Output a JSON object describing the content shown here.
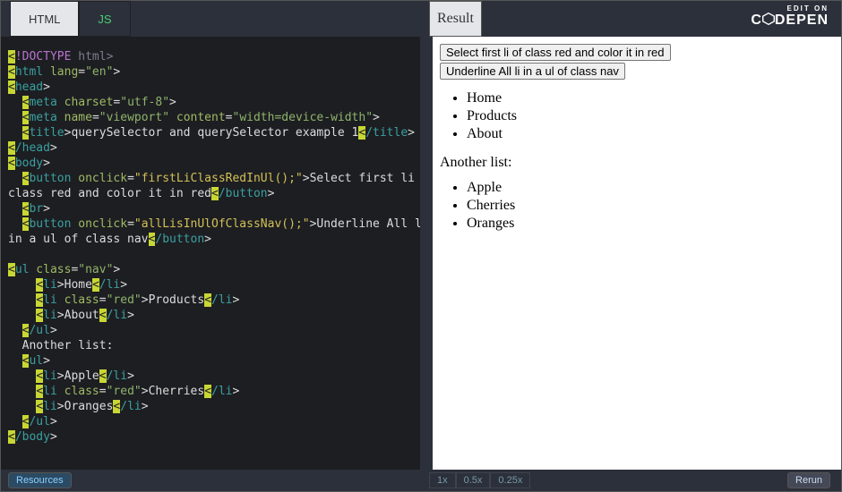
{
  "brand": {
    "tagline": "EDIT ON",
    "name": "C   DEPEN"
  },
  "tabs": {
    "html": "HTML",
    "js": "JS",
    "result": "Result"
  },
  "code": {
    "l1a": "<",
    "l1b": "!DOCTYPE",
    "l1c": " html",
    "l1d": ">",
    "l2a": "<",
    "l2b": "html",
    "l2c": " lang",
    "l2d": "=",
    "l2e": "\"en\"",
    "l2f": ">",
    "l3a": "<",
    "l3b": "head",
    "l3c": ">",
    "l4a": "<",
    "l4b": "meta",
    "l4c": " charset",
    "l4d": "=",
    "l4e": "\"utf-8\"",
    "l4f": ">",
    "l5a": "<",
    "l5b": "meta",
    "l5c": " name",
    "l5d": "=",
    "l5e": "\"viewport\"",
    "l5f": " content",
    "l5g": "=",
    "l5h": "\"width=device-width\"",
    "l5i": ">",
    "l6a": "<",
    "l6b": "title",
    "l6c": ">",
    "l6d": "querySelector and querySelector example 1",
    "l6e": "<",
    "l6f": "/title",
    "l6g": ">",
    "l7a": "<",
    "l7b": "/head",
    "l7c": ">",
    "l8a": "<",
    "l8b": "body",
    "l8c": ">",
    "l9a": "<",
    "l9b": "button",
    "l9c": " onclick",
    "l9d": "=",
    "l9e": "\"firstLiClassRedInUl();\"",
    "l9f": ">",
    "l9g1": "Select first li of ",
    "l9g2": "class red and color it in red",
    "l9h": "<",
    "l9i": "/button",
    "l9j": ">",
    "l10a": "<",
    "l10b": "br",
    "l10c": ">",
    "l11a": "<",
    "l11b": "button",
    "l11c": " onclick",
    "l11d": "=",
    "l11e": "\"allLisInUlOfClassNav();\"",
    "l11f": ">",
    "l11g1": "Underline All li ",
    "l11g2": "in a ul of class nav",
    "l11h": "<",
    "l11i": "/button",
    "l11j": ">",
    "l12a": "<",
    "l12b": "ul",
    "l12c": " class",
    "l12d": "=",
    "l12e": "\"nav\"",
    "l12f": ">",
    "l13a": "<",
    "l13b": "li",
    "l13c": ">",
    "l13d": "Home",
    "l13e": "<",
    "l13f": "/li",
    "l13g": ">",
    "l14a": "<",
    "l14b": "li",
    "l14c": " class",
    "l14d": "=",
    "l14e": "\"red\"",
    "l14f": ">",
    "l14g": "Products",
    "l14h": "<",
    "l14i": "/li",
    "l14j": ">",
    "l15a": "<",
    "l15b": "li",
    "l15c": ">",
    "l15d": "About",
    "l15e": "<",
    "l15f": "/li",
    "l15g": ">",
    "l16a": "<",
    "l16b": "/ul",
    "l16c": ">",
    "l17": "Another list:",
    "l18a": "<",
    "l18b": "ul",
    "l18c": ">",
    "l19a": "<",
    "l19b": "li",
    "l19c": ">",
    "l19d": "Apple",
    "l19e": "<",
    "l19f": "/li",
    "l19g": ">",
    "l20a": "<",
    "l20b": "li",
    "l20c": " class",
    "l20d": "=",
    "l20e": "\"red\"",
    "l20f": ">",
    "l20g": "Cherries",
    "l20h": "<",
    "l20i": "/li",
    "l20j": ">",
    "l21a": "<",
    "l21b": "li",
    "l21c": ">",
    "l21d": "Oranges",
    "l21e": "<",
    "l21f": "/li",
    "l21g": ">",
    "l22a": "<",
    "l22b": "/ul",
    "l22c": ">",
    "l23a": "<",
    "l23b": "/body",
    "l23c": ">"
  },
  "result": {
    "button1": "Select first li of class red and color it in red",
    "button2": "Underline All li in a ul of class nav",
    "list1": [
      "Home",
      "Products",
      "About"
    ],
    "inter": "Another list:",
    "list2": [
      "Apple",
      "Cherries",
      "Oranges"
    ]
  },
  "footer": {
    "resources": "Resources",
    "speeds": [
      "1x",
      "0.5x",
      "0.25x"
    ],
    "rerun": "Rerun"
  }
}
